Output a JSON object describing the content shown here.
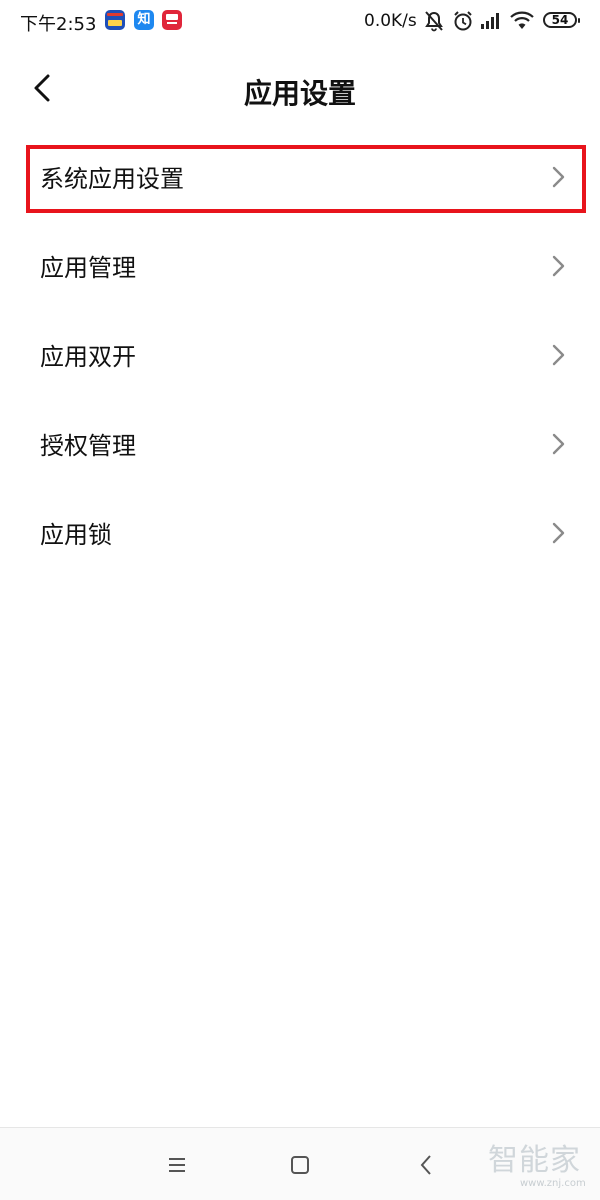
{
  "status_bar": {
    "time": "下午2:53",
    "app_icon_label": "知",
    "net_speed": "0.0K/s",
    "battery": "54",
    "icons": [
      "notification-app-icon",
      "zhihu-app-icon",
      "tmall-app-icon",
      "mute-icon",
      "alarm-icon",
      "signal-icon",
      "wifi-icon",
      "battery-icon"
    ]
  },
  "header": {
    "title": "应用设置",
    "back_icon": "back-arrow-icon"
  },
  "menu": {
    "items": [
      {
        "label": "系统应用设置"
      },
      {
        "label": "应用管理"
      },
      {
        "label": "应用双开"
      },
      {
        "label": "授权管理"
      },
      {
        "label": "应用锁"
      }
    ],
    "highlighted_index": 0,
    "highlight_color": "#e8141c"
  },
  "navbar": {
    "icons": [
      "menu-icon",
      "home-icon",
      "back-icon"
    ]
  },
  "watermark": {
    "text": "智能家",
    "url": "www.znj.com"
  }
}
